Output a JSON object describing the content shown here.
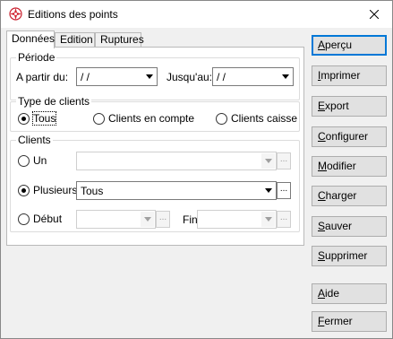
{
  "window": {
    "title": "Editions des points"
  },
  "tabs": [
    {
      "label": "Données",
      "active": true
    },
    {
      "label": "Edition",
      "active": false
    },
    {
      "label": "Ruptures",
      "active": false
    }
  ],
  "periode": {
    "title": "Période",
    "from_label": "A partir du:",
    "from_value": " / /",
    "to_label": "Jusqu'au:",
    "to_value": " / /"
  },
  "type_clients": {
    "title": "Type de clients",
    "options": [
      {
        "label": "Tous",
        "checked": true
      },
      {
        "label": "Clients en compte",
        "checked": false
      },
      {
        "label": "Clients caisse",
        "checked": false
      }
    ]
  },
  "clients": {
    "title": "Clients",
    "un_label": "Un",
    "plusieurs_label": "Plusieurs",
    "plusieurs_value": "Tous",
    "debut_label": "Début",
    "fin_label": "Fin",
    "dots": "..."
  },
  "buttons": [
    {
      "key": "apercu",
      "accel": "A",
      "rest": "perçu",
      "default": true
    },
    {
      "key": "imprimer",
      "accel": "I",
      "rest": "mprimer",
      "default": false
    },
    {
      "key": "export",
      "accel": "E",
      "rest": "xport",
      "default": false
    },
    {
      "key": "configurer",
      "accel": "C",
      "rest": "onfigurer",
      "default": false
    },
    {
      "key": "modifier",
      "accel": "M",
      "rest": "odifier",
      "default": false
    },
    {
      "key": "charger",
      "accel": "C",
      "rest": "harger",
      "default": false
    },
    {
      "key": "sauver",
      "accel": "S",
      "rest": "auver",
      "default": false
    },
    {
      "key": "supprimer",
      "accel": "S",
      "rest": "upprimer",
      "default": false
    },
    {
      "key": "aide",
      "accel": "A",
      "rest": "ide",
      "default": false
    },
    {
      "key": "fermer",
      "accel": "F",
      "rest": "ermer",
      "default": false
    }
  ]
}
